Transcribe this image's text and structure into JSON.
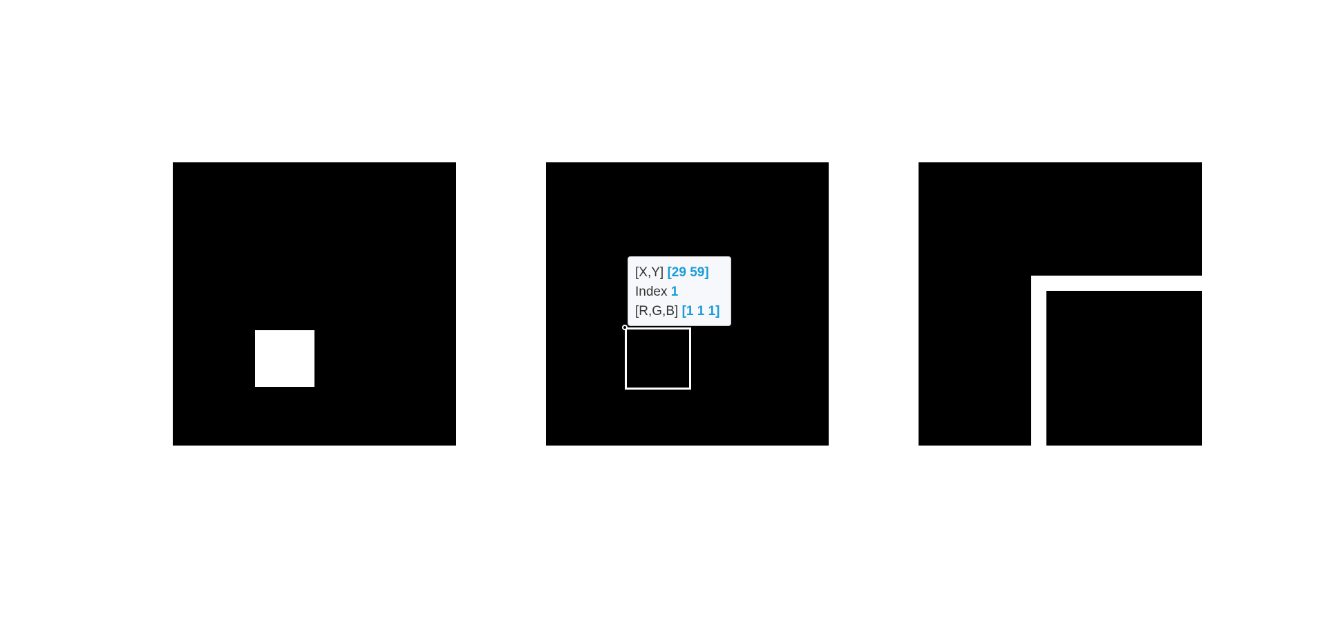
{
  "tooltip": {
    "xy_label": "[X,Y]",
    "xy_value": "[29 59]",
    "index_label": "Index",
    "index_value": "1",
    "rgb_label": "[R,G,B]",
    "rgb_value": "[1 1 1]"
  },
  "colors": {
    "background": "#ffffff",
    "image": "#000000",
    "accent": "#1a9bd7"
  }
}
